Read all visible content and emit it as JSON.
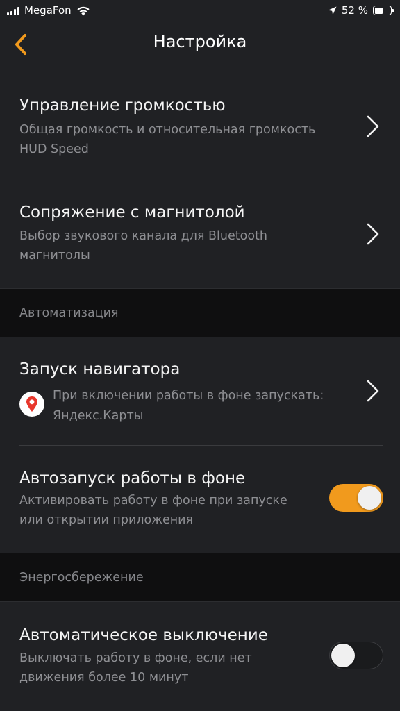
{
  "status_bar": {
    "carrier": "MegaFon",
    "battery_percent": "52 %",
    "battery_level": 0.52
  },
  "header": {
    "title": "Настройка",
    "back_icon": "chevron-left-icon",
    "accent_color": "#f19a1d"
  },
  "settings": {
    "volume": {
      "title": "Управление громкостью",
      "subtitle_line1": "Общая громкость и относительная громкость",
      "subtitle_line2": "HUD Speed"
    },
    "pairing": {
      "title": "Сопряжение с магнитолой",
      "subtitle_line1": "Выбор звукового канала для Bluetooth",
      "subtitle_line2": "магнитолы"
    }
  },
  "automation": {
    "header": "Автоматизация",
    "navigator": {
      "title": "Запуск навигатора",
      "subtitle_line1": "При включении работы в фоне запускать:",
      "subtitle_line2": "Яндекс.Карты",
      "icon": "yandex-maps-icon"
    },
    "autostart": {
      "title": "Автозапуск работы в фоне",
      "subtitle_line1": "Активировать работу в фоне при запуске",
      "subtitle_line2": "или открытии приложения",
      "enabled": true
    }
  },
  "power": {
    "header": "Энергосбережение",
    "auto_off": {
      "title": "Автоматическое выключение",
      "subtitle_line1": "Выключать работу в фоне, если нет",
      "subtitle_line2": "движения более 10 минут",
      "enabled": false
    }
  }
}
